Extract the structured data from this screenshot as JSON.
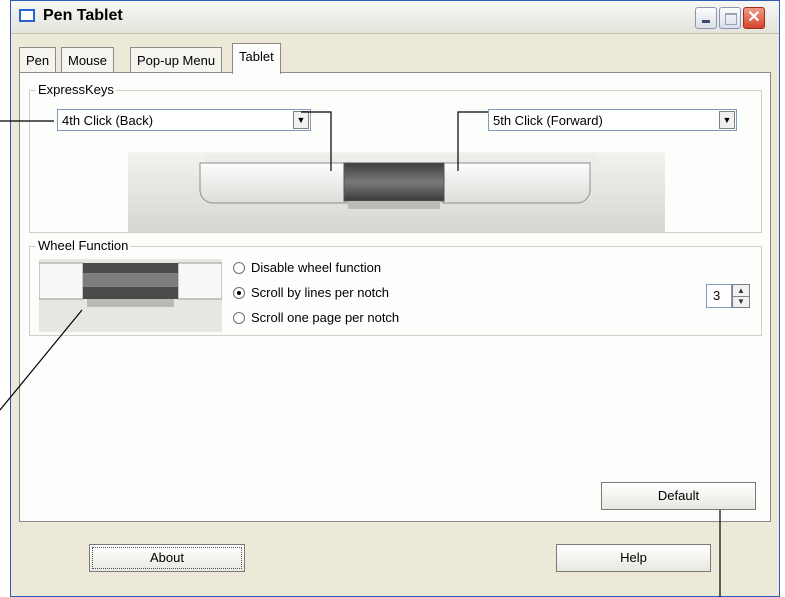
{
  "window": {
    "title": "Pen Tablet",
    "icon": "tablet-window-icon",
    "controls": {
      "minimize": "minimize-icon",
      "maximize": "maximize-icon",
      "close": "close-icon",
      "close_glyph": "✕"
    }
  },
  "tabs": [
    {
      "label": "Pen",
      "active": false
    },
    {
      "label": "Mouse",
      "active": false
    },
    {
      "label": "Pop-up Menu",
      "active": false
    },
    {
      "label": "Tablet",
      "active": true
    }
  ],
  "expresskeys": {
    "label": "ExpressKeys",
    "left_select": {
      "value": "4th Click (Back)"
    },
    "right_select": {
      "value": "5th Click (Forward)"
    }
  },
  "wheel": {
    "label": "Wheel Function",
    "options": [
      {
        "label": "Disable wheel function",
        "checked": false
      },
      {
        "label": "Scroll by lines per notch",
        "checked": true
      },
      {
        "label": "Scroll one page per notch",
        "checked": false
      }
    ],
    "lines_per_notch": "3"
  },
  "buttons": {
    "default": "Default",
    "about": "About",
    "help": "Help"
  },
  "glyphs": {
    "dropdown": "▼",
    "up": "▲",
    "down": "▼"
  }
}
